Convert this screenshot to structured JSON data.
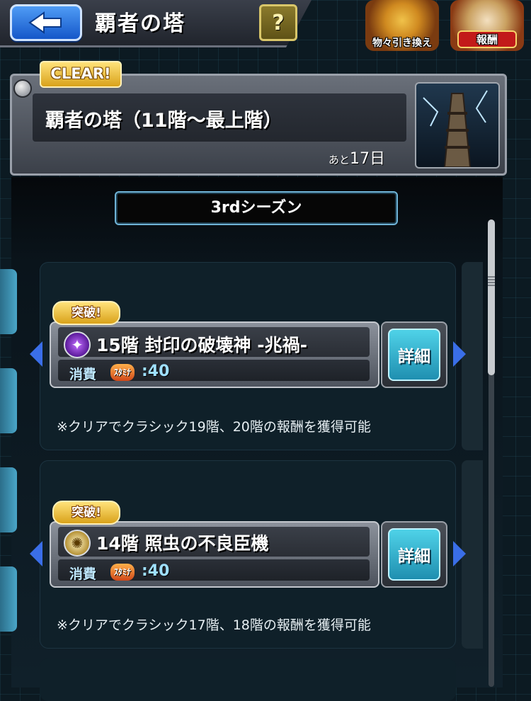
{
  "header": {
    "title": "覇者の塔",
    "help_label": "?",
    "exchange_label": "物々引き換え",
    "reward_label": "報酬"
  },
  "quest": {
    "clear_badge": "CLEAR!",
    "title": "覇者の塔（11階～最上階）",
    "remaining_prefix": "あと",
    "remaining_value": "17日"
  },
  "season": {
    "label": "3rdシーズン"
  },
  "stages": [
    {
      "badge": "突破!",
      "element_icon": "dark-element-icon",
      "name": "15階 封印の破壊神 -兆禍-",
      "cost_label": "消費",
      "stamina_label": "ｽﾀﾐﾅ",
      "cost_value": ":40",
      "detail_label": "詳細",
      "note": "※クリアでクラシック19階、20階の報酬を獲得可能"
    },
    {
      "badge": "突破!",
      "element_icon": "light-element-icon",
      "name": "14階 照虫の不良臣機",
      "cost_label": "消費",
      "stamina_label": "ｽﾀﾐﾅ",
      "cost_value": ":40",
      "detail_label": "詳細",
      "note": "※クリアでクラシック17階、18階の報酬を獲得可能"
    }
  ]
}
